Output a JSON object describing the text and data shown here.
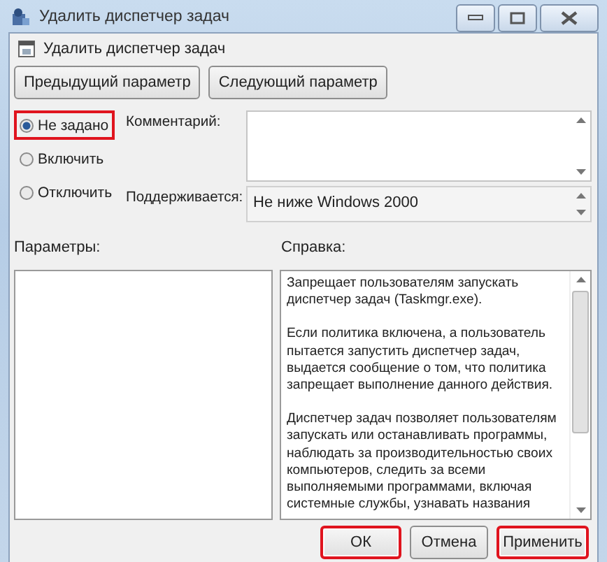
{
  "window": {
    "title": "Удалить диспетчер задач"
  },
  "policy_title": "Удалить диспетчер задач",
  "nav_buttons": [
    "Предыдущий параметр",
    "Следующий параметр"
  ],
  "state_options": [
    {
      "label": "Не задано",
      "selected": true,
      "highlighted": true
    },
    {
      "label": "Включить",
      "selected": false,
      "highlighted": false
    },
    {
      "label": "Отключить",
      "selected": false,
      "highlighted": false
    }
  ],
  "comment": {
    "label": "Комментарий:"
  },
  "supported": {
    "label": "Поддерживается:",
    "value": "Не ниже Windows 2000"
  },
  "options_label": "Параметры:",
  "help": {
    "label": "Справка:",
    "paragraphs": [
      "Запрещает пользователям запускать диспетчер задач (Taskmgr.exe).",
      "Если политика включена, а пользователь пытается запустить диспетчер задач, выдается сообщение о том, что политика запрещает выполнение данного действия.",
      "Диспетчер задач позволяет пользователям запускать или останавливать программы, наблюдать за производительностью своих компьютеров, следить за всеми выполняемыми программами, включая системные службы, узнавать названия"
    ]
  },
  "buttons": [
    {
      "label": "ОК",
      "highlighted": true
    },
    {
      "label": "Отмена",
      "highlighted": false
    },
    {
      "label": "Применить",
      "highlighted": true
    }
  ]
}
